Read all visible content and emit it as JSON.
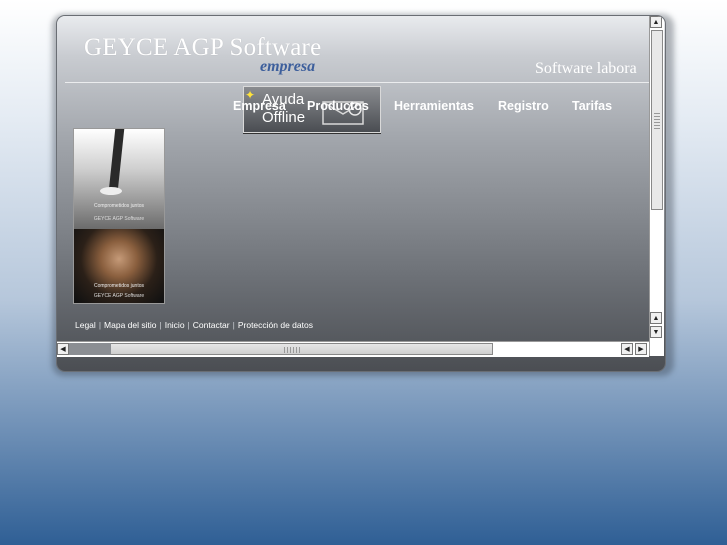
{
  "header": {
    "brand": "GEYCE AGP Software",
    "brand_sub": "empresa",
    "tagline": "Software labora"
  },
  "nav": {
    "items": [
      {
        "label": "Empresa"
      },
      {
        "label": "Productos"
      },
      {
        "label": "Herramientas"
      },
      {
        "label": "Registro"
      },
      {
        "label": "Tarifas"
      }
    ]
  },
  "ayuda": {
    "line1": "Ayuda",
    "line2": "Offline"
  },
  "photo": {
    "caption1": "Comprometidos juntos",
    "caption2": "GEYCE AGP Software",
    "caption3": "Comprometidos juntos",
    "caption4": "GEYCE AGP Software"
  },
  "footer": {
    "links": [
      {
        "label": "Legal"
      },
      {
        "label": "Mapa del sitio"
      },
      {
        "label": "Inicio"
      },
      {
        "label": "Contactar"
      },
      {
        "label": "Protección de datos"
      }
    ],
    "separator": "|"
  },
  "colors": {
    "brand_sub": "#3d5f9c",
    "accent_yellow": "#ffe23a"
  }
}
